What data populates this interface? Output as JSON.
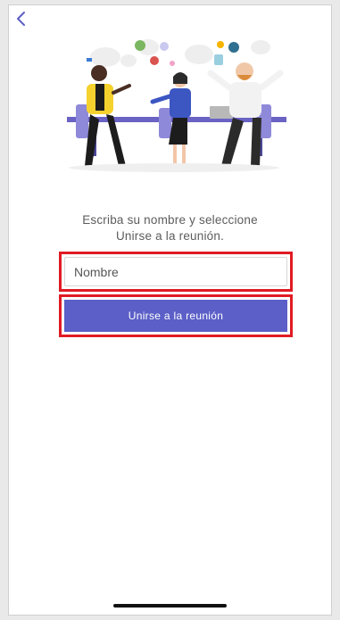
{
  "nav": {
    "back_icon": "chevron-left-icon"
  },
  "illustration": {
    "description_icon": "meeting-people-illustration"
  },
  "instructions": {
    "line1": "Escriba su nombre y seleccione",
    "line2": "Unirse a la reunión."
  },
  "form": {
    "name_placeholder": "Nombre",
    "name_value": "",
    "join_label": "Unirse a la reunión"
  },
  "colors": {
    "accent": "#5b5fc7",
    "highlight": "#e01b24",
    "background": "#ffffff"
  }
}
